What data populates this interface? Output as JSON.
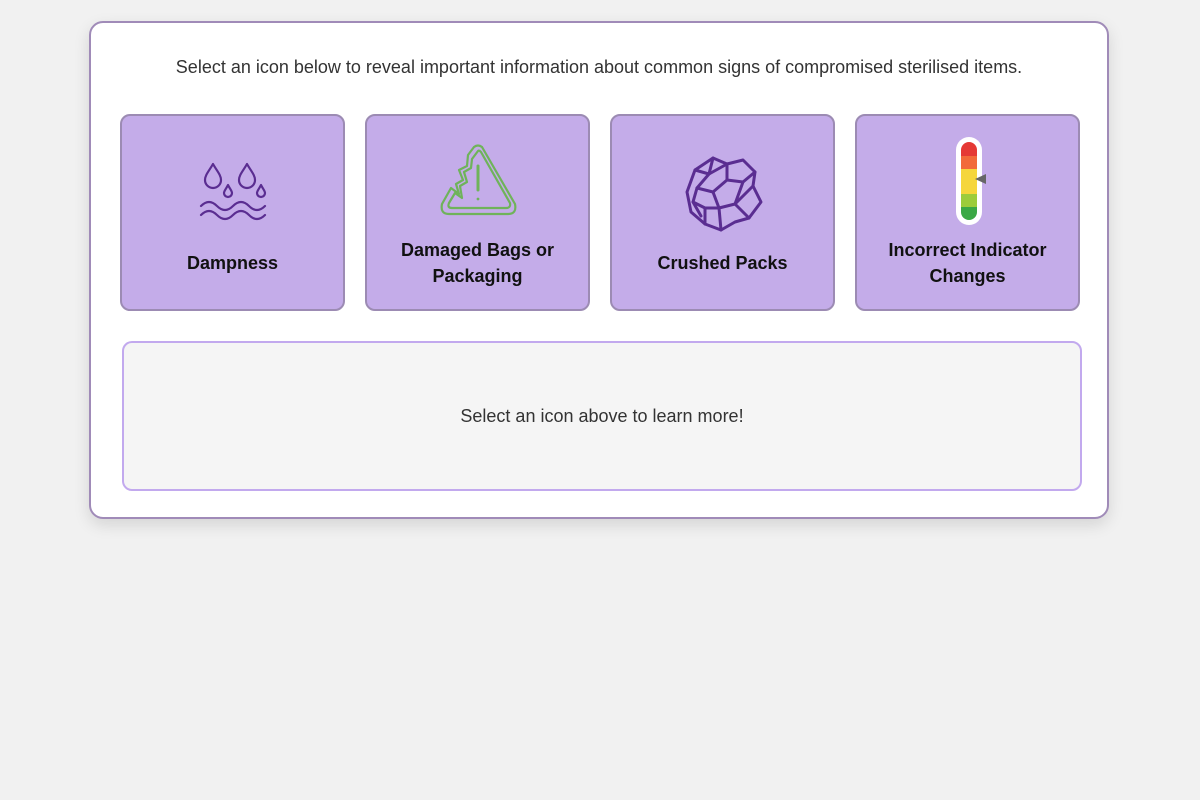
{
  "intro_text": "Select an icon below to reveal important information about common signs of compromised sterilised items.",
  "cards": [
    {
      "label": "Dampness",
      "icon": "water-drops-icon"
    },
    {
      "label": "Damaged Bags or Packaging",
      "icon": "torn-warning-triangle-icon"
    },
    {
      "label": "Crushed Packs",
      "icon": "crumpled-paper-icon"
    },
    {
      "label": "Incorrect Indicator Changes",
      "icon": "color-indicator-gauge-icon"
    }
  ],
  "info_placeholder": "Select an icon above to learn more!",
  "colors": {
    "card_background": "#c4ace9",
    "icon_purple": "#5a2d91",
    "icon_green": "#6fb35a",
    "indicator_red": "#e53935",
    "indicator_orange": "#f26a3a",
    "indicator_yellow": "#f5d63b",
    "indicator_lightgreen": "#9ccc3b",
    "indicator_green": "#3aa845"
  }
}
